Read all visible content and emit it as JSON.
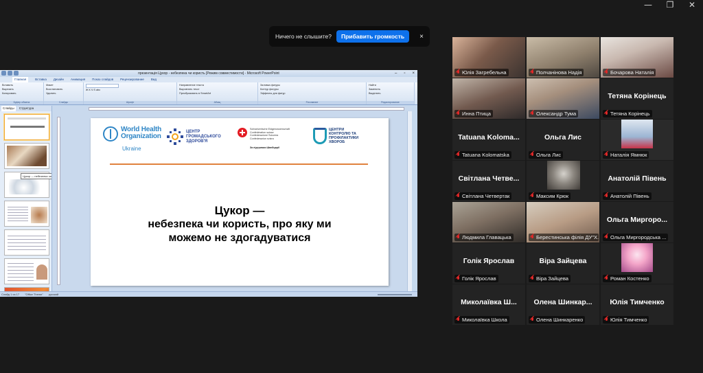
{
  "notification": {
    "message": "Ничего не слышите?",
    "action_label": "Прибавить громкость",
    "close_glyph": "×"
  },
  "window_controls": {
    "minimize": "—",
    "restore": "❐",
    "close": "✕"
  },
  "powerpoint": {
    "title": "презентація Цукор - небезпека чи користь [Режим совместимости] - Microsoft PowerPoint",
    "tabs": [
      "Главная",
      "Вставка",
      "Дизайн",
      "Анимация",
      "Показ слайдов",
      "Рецензирование",
      "Вид"
    ],
    "ribbon": {
      "clipboard": {
        "group": "Буфер обмена",
        "items": [
          "Вставить",
          "Вырезать",
          "Копировать",
          "Формат по образцу"
        ]
      },
      "slides": {
        "group": "Слайды",
        "items": [
          "Создать слайд",
          "Макет",
          "Восстановить",
          "Удалить"
        ]
      },
      "font": {
        "group": "Шрифт"
      },
      "paragraph": {
        "group": "Абзац",
        "items": [
          "Направление текста",
          "Выровнять текст",
          "Преобразовать в SmartArt"
        ]
      },
      "drawing": {
        "group": "Рисование",
        "items": [
          "Упорядочить",
          "Экспресс-стили",
          "Заливка фигуры",
          "Контур фигуры",
          "Эффекты для фигур"
        ]
      },
      "editing": {
        "group": "Редактирование",
        "items": [
          "Найти",
          "Заменить",
          "Выделить"
        ]
      }
    },
    "pane_tabs": [
      "Слайды",
      "Структура"
    ],
    "tooltip": "Цукор — небезпека чи користь ...",
    "status": {
      "slide": "Слайд 1 из 17",
      "theme": "\"Office Theme\"",
      "language": "русский"
    }
  },
  "slide": {
    "who_name": "World Health Organization",
    "who_country": "Ukraine",
    "cgz": "ЦЕНТР ГРОМАДСЬКОГО ЗДОРОВ'Я",
    "swiss_lines": [
      "Schweizerische Eidgenossenschaft",
      "Confédération suisse",
      "Confederazione Svizzera",
      "Confederaziun svizra"
    ],
    "swiss_support": "За підтримки Швейцарії",
    "ckp": "ЦЕНТРИ КОНТРОЛЮ ТА ПРОФІЛАКТИКИ ХВОРОБ",
    "heading_line1": "Цукор —",
    "heading_line2": "небезпека чи користь, про яку ми",
    "heading_line3": "можемо не здогадуватися"
  },
  "thumbs": [
    {
      "n": "1"
    },
    {
      "n": "2"
    },
    {
      "n": "3"
    },
    {
      "n": "4"
    },
    {
      "n": "5"
    },
    {
      "n": "6"
    },
    {
      "n": "7"
    }
  ],
  "participants": [
    {
      "name": "Юлія Загребельна",
      "video": "v-julia"
    },
    {
      "name": "Полчанінова Надія",
      "video": "v-nadia"
    },
    {
      "name": "Бочарова Наталія",
      "video": "v-natalia-b"
    },
    {
      "name": "Инна Птица",
      "video": "v-inna"
    },
    {
      "name": "Олександр Тума",
      "video": "v-oleks"
    },
    {
      "name": "Тетяна Корінець",
      "big": "Тетяна Корінець"
    },
    {
      "name": "Tatuana Kolomatska",
      "big": "Tatuana  Koloma..."
    },
    {
      "name": "Ольга Лис",
      "big": "Ольга Лис"
    },
    {
      "name": "Наталія Ямнюк",
      "video": "v-yamniuk"
    },
    {
      "name": "Світлана Четвертак",
      "big": "Світлана  Четве..."
    },
    {
      "name": "Максим Крюк",
      "video": "v-kriuk"
    },
    {
      "name": "Анатолій Півень",
      "big": "Анатолій  Півень"
    },
    {
      "name": "Людмила Главацька",
      "video": "v-liudmyla"
    },
    {
      "name": "Берестинська філія ДУ\"Х...",
      "video": "v-berest",
      "active": true
    },
    {
      "name": "Ольга Миргородська ...",
      "big": "Ольга  Миргоро..."
    },
    {
      "name": "Голік Ярослав",
      "big": "Голік  Ярослав"
    },
    {
      "name": "Віра Зайцева",
      "big": "Віра  Зайцева"
    },
    {
      "name": "Роман Костенко",
      "video": "v-roman"
    },
    {
      "name": "Миколаївка Школа",
      "big": "Миколаївка  Ш..."
    },
    {
      "name": "Олена Шинкаренко",
      "big": "Олена  Шинкар..."
    },
    {
      "name": "Юлія Тимченко",
      "big": "Юлія  Тимченко"
    }
  ]
}
